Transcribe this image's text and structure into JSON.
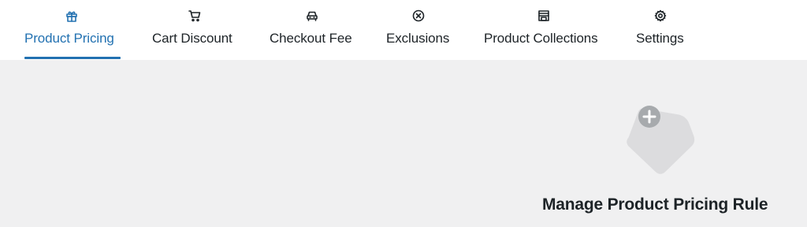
{
  "tabs": [
    {
      "label": "Product Pricing",
      "icon": "gift-icon",
      "active": true
    },
    {
      "label": "Cart Discount",
      "icon": "cart-icon",
      "active": false
    },
    {
      "label": "Checkout Fee",
      "icon": "car-icon",
      "active": false
    },
    {
      "label": "Exclusions",
      "icon": "circle-x-icon",
      "active": false
    },
    {
      "label": "Product Collections",
      "icon": "store-icon",
      "active": false
    },
    {
      "label": "Settings",
      "icon": "gear-icon",
      "active": false
    }
  ],
  "main": {
    "empty_title": "Manage Product Pricing Rule"
  },
  "colors": {
    "accent": "#2271b1",
    "text": "#1d2327",
    "background": "#f0f0f1",
    "illustration": "#dcdcde",
    "illustration_badge": "#a7aaad"
  }
}
